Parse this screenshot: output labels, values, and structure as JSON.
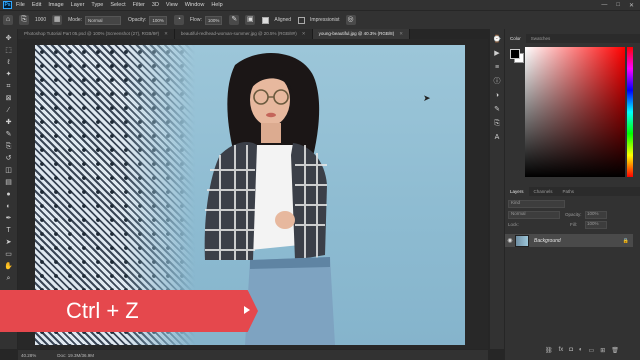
{
  "app": {
    "logo": "Ps"
  },
  "menu": {
    "items": [
      "File",
      "Edit",
      "Image",
      "Layer",
      "Type",
      "Select",
      "Filter",
      "3D",
      "View",
      "Window",
      "Help"
    ]
  },
  "options": {
    "mode_label": "Mode:",
    "mode_value": "Normal",
    "opacity_label": "Opacity:",
    "opacity_value": "100%",
    "flow_label": "Flow:",
    "flow_value": "100%",
    "aligned_label": "Aligned",
    "impressionist_label": "Impressionist",
    "brush_size": "1000"
  },
  "tabs": [
    {
      "label": "Photoshop Tutorial Part 05.psd @ 100% (Screenshot (27), RGB/8#)",
      "active": false
    },
    {
      "label": "beautiful-redhead-woman-summer.jpg @ 20.5% (RGB/8#)",
      "active": false
    },
    {
      "label": "young-beautiful.jpg @ 40.3% (RGB/8)",
      "active": true
    }
  ],
  "color_panel": {
    "tabs": [
      "Color",
      "Swatches"
    ]
  },
  "layers_panel": {
    "tabs": [
      "Layers",
      "Channels",
      "Paths"
    ],
    "kind_label": "Kind",
    "blend_mode": "Normal",
    "opacity_label": "Opacity:",
    "opacity_value": "100%",
    "lock_label": "Lock:",
    "fill_label": "Fill:",
    "fill_value": "100%",
    "layer_name": "Background"
  },
  "status": {
    "zoom": "40.28%",
    "doc": "Doc: 19.3M/36.9M"
  },
  "banner": {
    "text": "Ctrl + Z",
    "color": "#e5484d"
  }
}
